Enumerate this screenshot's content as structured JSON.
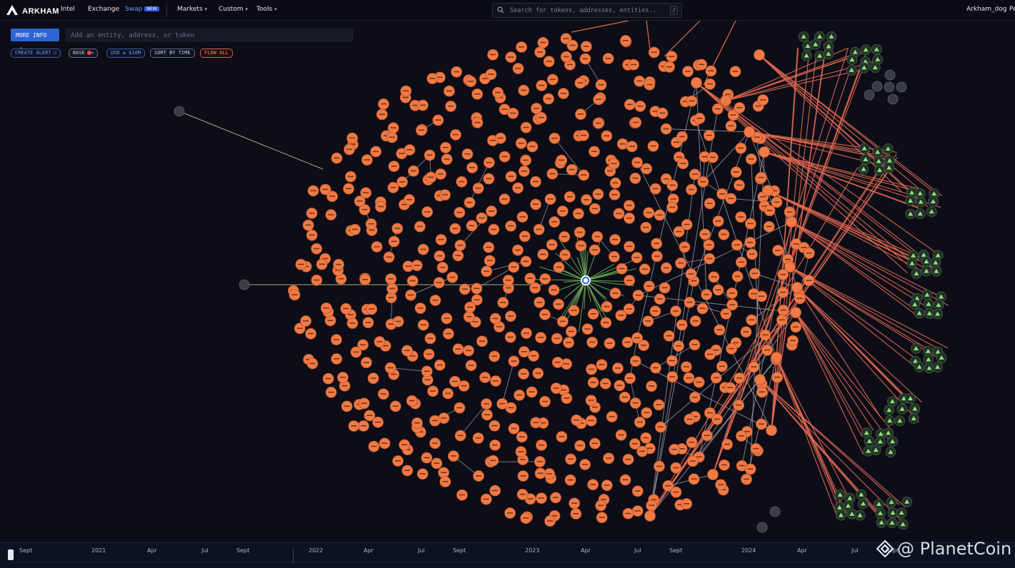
{
  "app": {
    "brand": "ARKHAM",
    "username": "Arkham_dog",
    "user_extra": "Pe"
  },
  "nav": {
    "items": [
      {
        "label": "Intel",
        "dropdown": false
      },
      {
        "label": "Exchange",
        "dropdown": false
      },
      {
        "label": "Swap",
        "dropdown": false,
        "badge": "NEW"
      },
      {
        "label": "Markets",
        "dropdown": true
      },
      {
        "label": "Custom",
        "dropdown": true
      },
      {
        "label": "Tools",
        "dropdown": true
      }
    ]
  },
  "search": {
    "placeholder": "Search for tokens, addresses, entities...",
    "shortcut": "/"
  },
  "toolbar": {
    "more_info_label": "MORE INFO",
    "entity_placeholder": "Add an entity, address, or token",
    "chips": {
      "create_alert": "CREATE ALERT",
      "base": "BASE",
      "usd_filter": "USD ≥ $10M",
      "sort": "SORT BY TIME",
      "flow": "FLOW ALL"
    }
  },
  "colors": {
    "background": "#0c0d17",
    "accent": "#2f64d6",
    "node": "#f07a45",
    "flow_edge": "#e46a52",
    "center_edge": "#6fae58",
    "edge": "#c9c9d2",
    "leaf_node": "#223126",
    "leaf_glyph": "#8fe07a"
  },
  "icons": {
    "logo": "arkham-logo-icon",
    "search": "search-icon",
    "center": "center-entity-icon",
    "watermark": "diamond-logo-icon"
  },
  "timeline": {
    "labels": [
      "Sept",
      "2021",
      "Apr",
      "Jul",
      "Sept",
      "2022",
      "Apr",
      "Jul",
      "Sept",
      "2023",
      "Apr",
      "Jul",
      "Sept",
      "2024",
      "Apr",
      "Jul",
      "Sept"
    ]
  },
  "watermark": {
    "text": "@ PlanetCoin"
  }
}
